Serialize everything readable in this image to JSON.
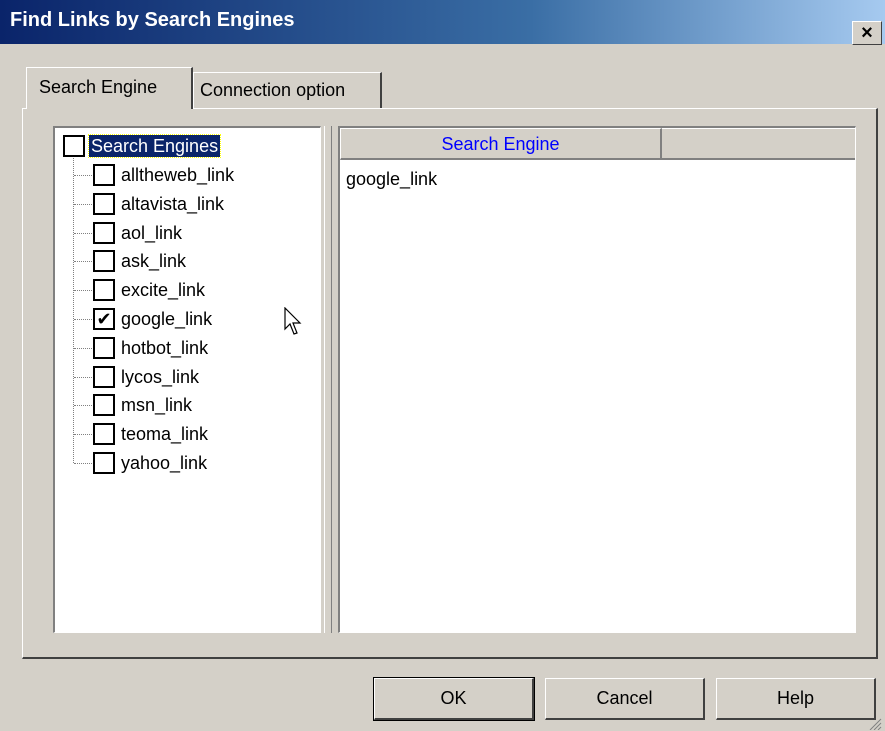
{
  "window": {
    "title": "Find Links by Search Engines",
    "close_glyph": "×"
  },
  "tabs": [
    {
      "label": "Search Engine",
      "active": true
    },
    {
      "label": "Connection option",
      "active": false
    }
  ],
  "tree": {
    "root": {
      "label": "Search Engines",
      "checked": false,
      "selected": true
    },
    "items": [
      {
        "label": "alltheweb_link",
        "checked": false
      },
      {
        "label": "altavista_link",
        "checked": false
      },
      {
        "label": "aol_link",
        "checked": false
      },
      {
        "label": "ask_link",
        "checked": false
      },
      {
        "label": "excite_link",
        "checked": false
      },
      {
        "label": "google_link",
        "checked": true
      },
      {
        "label": "hotbot_link",
        "checked": false
      },
      {
        "label": "lycos_link",
        "checked": false
      },
      {
        "label": "msn_link",
        "checked": false
      },
      {
        "label": "teoma_link",
        "checked": false
      },
      {
        "label": "yahoo_link",
        "checked": false
      }
    ]
  },
  "list": {
    "column_header": "Search Engine",
    "header_color": "#0000ff",
    "rows": [
      "google_link"
    ]
  },
  "buttons": {
    "ok": "OK",
    "cancel": "Cancel",
    "help": "Help"
  },
  "icons": {
    "check": "✔",
    "cursor": "arrow-cursor-icon",
    "grip": "resize-grip-icon"
  }
}
